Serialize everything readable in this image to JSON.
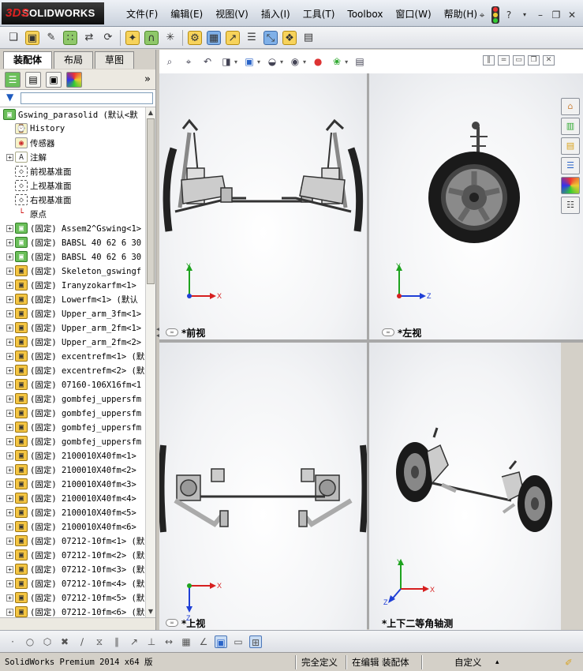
{
  "app": {
    "logo_prefix": "3DS",
    "logo_text": "SOLIDWORKS"
  },
  "menubar": [
    "文件(F)",
    "编辑(E)",
    "视图(V)",
    "插入(I)",
    "工具(T)",
    "Toolbox",
    "窗口(W)",
    "帮助(H)"
  ],
  "left_tabs": [
    "装配体",
    "布局",
    "草图"
  ],
  "tree": {
    "root": "Gswing_parasolid (默认<默",
    "items": [
      {
        "label": "History",
        "icon": "history-icon",
        "expandable": false
      },
      {
        "label": "传感器",
        "icon": "sensor-icon",
        "expandable": false
      },
      {
        "label": "注解",
        "icon": "annotation-icon",
        "expandable": true
      },
      {
        "label": "前视基准面",
        "icon": "plane-icon",
        "expandable": false
      },
      {
        "label": "上视基准面",
        "icon": "plane-icon",
        "expandable": false
      },
      {
        "label": "右视基准面",
        "icon": "plane-icon",
        "expandable": false
      },
      {
        "label": "原点",
        "icon": "origin-icon",
        "expandable": false
      },
      {
        "label": "(固定) Assem2^Gswing<1>",
        "icon": "subassembly-icon",
        "expandable": true
      },
      {
        "label": "(固定) BABSL 40 62 6 30",
        "icon": "subassembly-icon",
        "expandable": true
      },
      {
        "label": "(固定) BABSL 40 62 6 30",
        "icon": "subassembly-icon",
        "expandable": true
      },
      {
        "label": "(固定) Skeleton_gswingf",
        "icon": "part-icon",
        "expandable": true
      },
      {
        "label": "(固定) Iranyzokarfm<1>",
        "icon": "part-icon",
        "expandable": true
      },
      {
        "label": "(固定) Lowerfm<1> (默认",
        "icon": "part-icon",
        "expandable": true
      },
      {
        "label": "(固定) Upper_arm_3fm<1>",
        "icon": "part-icon",
        "expandable": true
      },
      {
        "label": "(固定) Upper_arm_2fm<1>",
        "icon": "part-icon",
        "expandable": true
      },
      {
        "label": "(固定) Upper_arm_2fm<2>",
        "icon": "part-icon",
        "expandable": true
      },
      {
        "label": "(固定) excentrefm<1> (默",
        "icon": "part-icon",
        "expandable": true
      },
      {
        "label": "(固定) excentrefm<2> (默",
        "icon": "part-icon",
        "expandable": true
      },
      {
        "label": "(固定) 07160-106X16fm<1",
        "icon": "part-icon",
        "expandable": true
      },
      {
        "label": "(固定) gombfej_uppersfm",
        "icon": "part-icon",
        "expandable": true
      },
      {
        "label": "(固定) gombfej_uppersfm",
        "icon": "part-icon",
        "expandable": true
      },
      {
        "label": "(固定) gombfej_uppersfm",
        "icon": "part-icon",
        "expandable": true
      },
      {
        "label": "(固定) gombfej_uppersfm",
        "icon": "part-icon",
        "expandable": true
      },
      {
        "label": "(固定) 2100010X40fm<1>",
        "icon": "part-icon",
        "expandable": true
      },
      {
        "label": "(固定) 2100010X40fm<2>",
        "icon": "part-icon",
        "expandable": true
      },
      {
        "label": "(固定) 2100010X40fm<3>",
        "icon": "part-icon",
        "expandable": true
      },
      {
        "label": "(固定) 2100010X40fm<4>",
        "icon": "part-icon",
        "expandable": true
      },
      {
        "label": "(固定) 2100010X40fm<5>",
        "icon": "part-icon",
        "expandable": true
      },
      {
        "label": "(固定) 2100010X40fm<6>",
        "icon": "part-icon",
        "expandable": true
      },
      {
        "label": "(固定) 07212-10fm<1> (默",
        "icon": "part-icon",
        "expandable": true
      },
      {
        "label": "(固定) 07212-10fm<2> (默",
        "icon": "part-icon",
        "expandable": true
      },
      {
        "label": "(固定) 07212-10fm<3> (默",
        "icon": "part-icon",
        "expandable": true
      },
      {
        "label": "(固定) 07212-10fm<4> (默",
        "icon": "part-icon",
        "expandable": true
      },
      {
        "label": "(固定) 07212-10fm<5> (默",
        "icon": "part-icon",
        "expandable": true
      },
      {
        "label": "(固定) 07212-10fm<6> (默",
        "icon": "part-icon",
        "expandable": true
      }
    ]
  },
  "viewports": {
    "front": "*前视",
    "left": "*左视",
    "top": "*上视",
    "iso": "*上下二等角轴测"
  },
  "axes": {
    "x": "X",
    "y": "Y",
    "z": "Z"
  },
  "statusbar": {
    "app_version": "SolidWorks Premium 2014 x64 版",
    "definition": "完全定义",
    "mode": "在编辑 装配体",
    "units": "自定义"
  },
  "colors": {
    "axis_x": "#d61f1f",
    "axis_y": "#1fa31f",
    "axis_z": "#1f3fd6",
    "tree_part": "#f4c542",
    "tree_subassembly": "#6bbf5a"
  }
}
